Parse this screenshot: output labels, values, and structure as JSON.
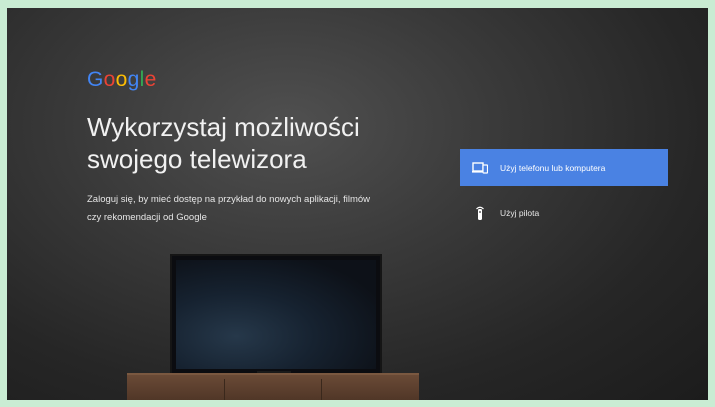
{
  "logo": {
    "letters": [
      {
        "char": "G",
        "color": "#4285F4"
      },
      {
        "char": "o",
        "color": "#EA4335"
      },
      {
        "char": "o",
        "color": "#FBBC05"
      },
      {
        "char": "g",
        "color": "#4285F4"
      },
      {
        "char": "l",
        "color": "#34A853"
      },
      {
        "char": "e",
        "color": "#EA4335"
      }
    ]
  },
  "heading": {
    "line1": "Wykorzystaj możliwości",
    "line2": "swojego telewizora"
  },
  "subtitle": {
    "line1": "Zaloguj się, by mieć dostęp na przykład do nowych aplikacji, filmów",
    "line2": "czy rekomendacji od Google"
  },
  "options": [
    {
      "label": "Użyj telefonu lub komputera",
      "icon": "phone-laptop-icon",
      "selected": true,
      "highlight_color": "#4a82e3"
    },
    {
      "label": "Użyj pilota",
      "icon": "remote-icon",
      "selected": false
    }
  ]
}
